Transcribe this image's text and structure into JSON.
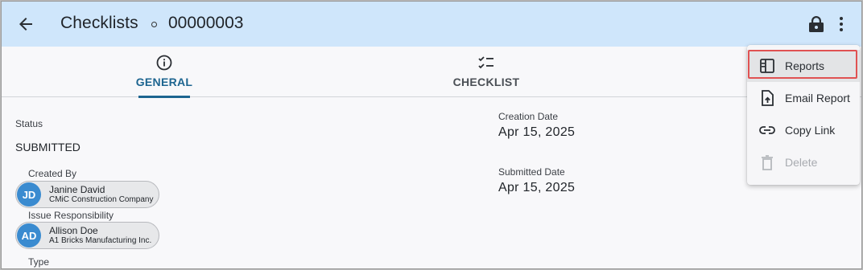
{
  "header": {
    "title": "Checklists",
    "record_id": "00000003",
    "background": "#cfe6fb"
  },
  "tabs": [
    {
      "label": "GENERAL",
      "icon": "info-icon",
      "active": true
    },
    {
      "label": "CHECKLIST",
      "icon": "checklist-icon",
      "active": false
    }
  ],
  "general": {
    "status_label": "Status",
    "status_value": "SUBMITTED",
    "created_by_label": "Created By",
    "created_by": {
      "initials": "JD",
      "name": "Janine David",
      "company": "CMiC Construction Company"
    },
    "issue_responsibility_label": "Issue Responsibility",
    "issue_responsibility": {
      "initials": "AD",
      "name": "Allison Doe",
      "company": "A1 Bricks Manufacturing Inc."
    },
    "type_label": "Type",
    "creation_date_label": "Creation Date",
    "creation_date": "Apr 15, 2025",
    "submitted_date_label": "Submitted Date",
    "submitted_date": "Apr 15, 2025"
  },
  "menu": {
    "items": [
      {
        "label": "Reports",
        "icon": "report-icon",
        "highlighted": true,
        "enabled": true
      },
      {
        "label": "Email Report",
        "icon": "email-report-icon",
        "enabled": true
      },
      {
        "label": "Copy Link",
        "icon": "link-icon",
        "enabled": true
      },
      {
        "label": "Delete",
        "icon": "trash-icon",
        "enabled": false
      }
    ]
  },
  "colors": {
    "accent": "#1d6590",
    "avatar": "#3a8bd0",
    "highlight": "#e05252"
  }
}
